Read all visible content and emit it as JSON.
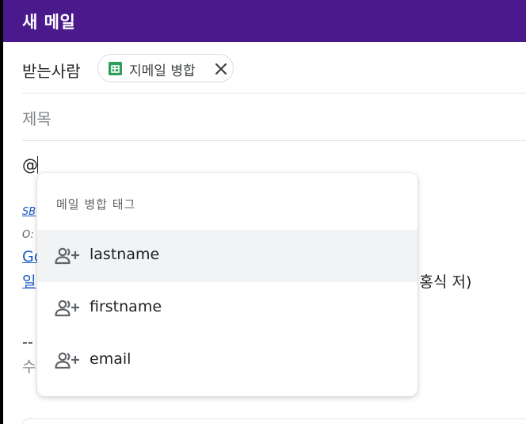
{
  "window": {
    "title": "새 메일"
  },
  "colors": {
    "title_bar": "#4a1a8c",
    "sheets_icon": "#2e9e5b",
    "link": "#1a57c4",
    "highlight": "#f1f3f4"
  },
  "to_row": {
    "label": "받는사람",
    "chip": {
      "label": "지메일 병합",
      "icon": "google-sheets-icon",
      "remove_icon": "close-icon"
    }
  },
  "subject": {
    "placeholder": "제목"
  },
  "body": {
    "typed_text": "@",
    "background_fragments": {
      "sb": "SB",
      "o": "O:",
      "go": "Go",
      "il": "일",
      "author": "최홍식 저)",
      "dash": "--",
      "su": "수"
    }
  },
  "mention_popup": {
    "header": "메일 병합 태그",
    "items": [
      {
        "label": "lastname",
        "icon": "person-add-icon",
        "highlighted": true
      },
      {
        "label": "firstname",
        "icon": "person-add-icon",
        "highlighted": false
      },
      {
        "label": "email",
        "icon": "person-add-icon",
        "highlighted": false
      }
    ]
  }
}
